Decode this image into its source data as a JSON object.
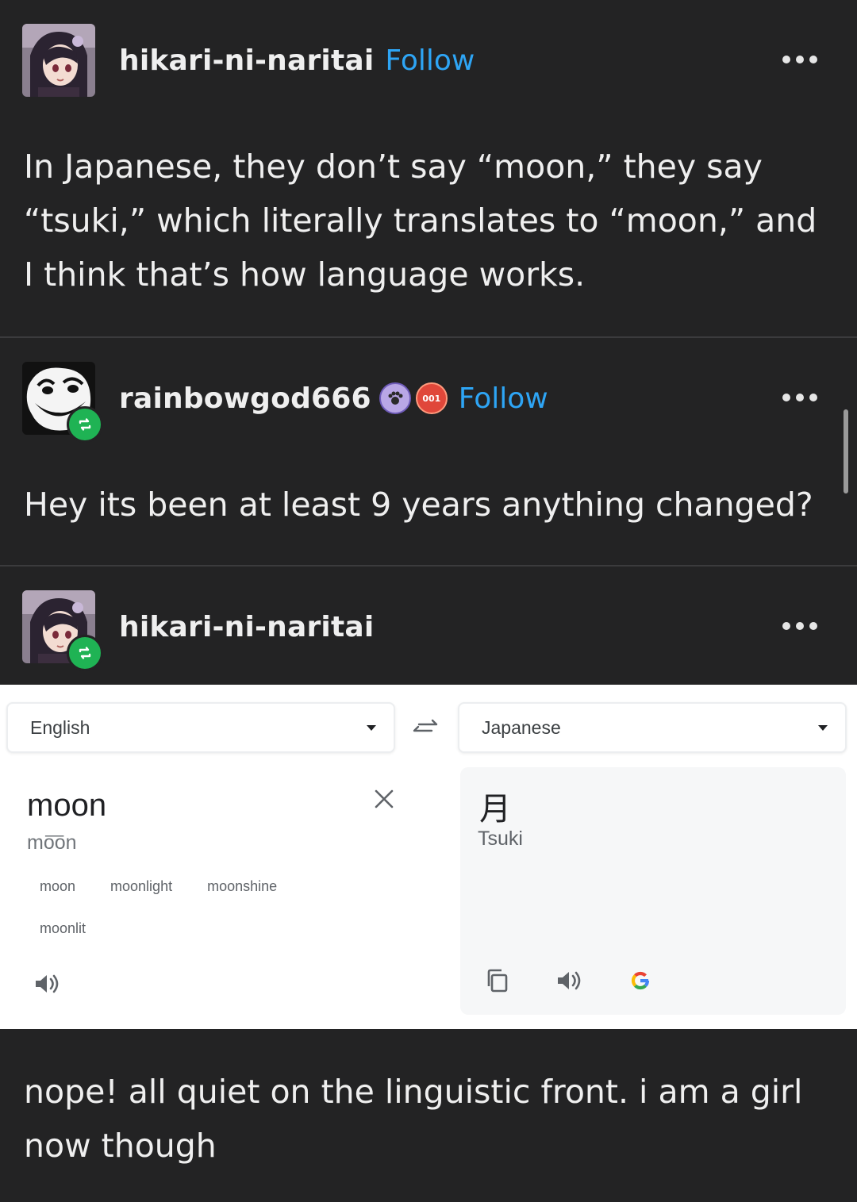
{
  "post1": {
    "username": "hikari-ni-naritai",
    "follow_label": "Follow",
    "text": "In Japanese, they don’t say “moon,” they say “tsuki,” which literally translates to “moon,” and I think that’s how language works."
  },
  "post2": {
    "username": "rainbowgod666",
    "follow_label": "Follow",
    "badge_seal_text": "001",
    "text": "Hey its been at least 9 years anything changed?"
  },
  "post3": {
    "username": "hikari-ni-naritai",
    "translate": {
      "source_lang": "English",
      "target_lang": "Japanese",
      "source_word": "moon",
      "source_phonetic": "mo͞on",
      "suggestions": [
        "moon",
        "moonlight",
        "moonshine",
        "moonlit"
      ],
      "target_kanji": "月",
      "target_romanization": "Tsuki"
    },
    "text": "nope! all quiet on the linguistic front. i am a girl now though"
  },
  "colors": {
    "background": "#222223",
    "follow_blue": "#2ea5f5",
    "reblog_green": "#1fb354"
  }
}
